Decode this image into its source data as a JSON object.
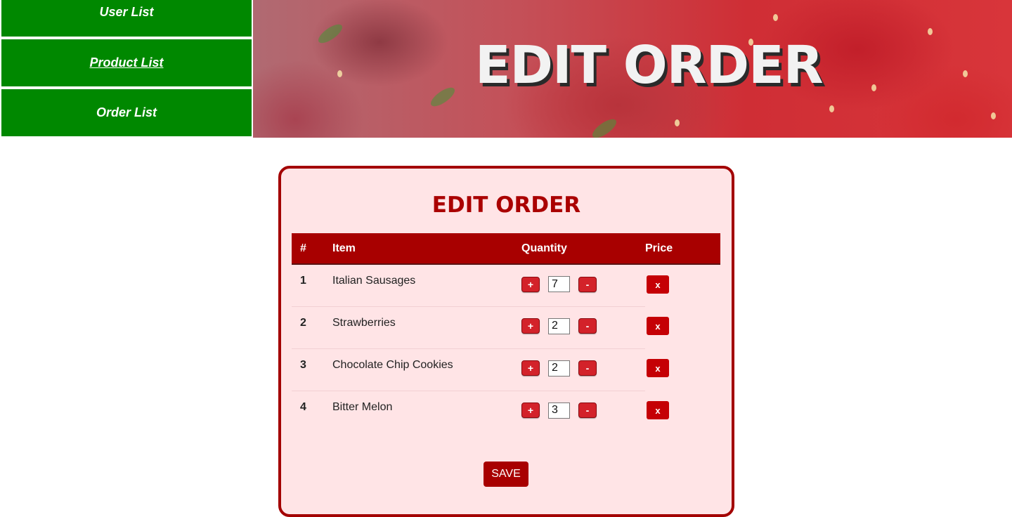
{
  "nav": {
    "items": [
      {
        "label": "User List"
      },
      {
        "label": "Product List"
      },
      {
        "label": "Order List"
      }
    ]
  },
  "hero": {
    "title": "EDIT ORDER"
  },
  "card": {
    "title": "EDIT ORDER",
    "table": {
      "headers": {
        "num": "#",
        "item": "Item",
        "quantity": "Quantity",
        "price": "Price"
      },
      "rows": [
        {
          "num": "1",
          "item": "Italian Sausages",
          "qty": "7"
        },
        {
          "num": "2",
          "item": "Strawberries",
          "qty": "2"
        },
        {
          "num": "3",
          "item": "Chocolate Chip Cookies",
          "qty": "2"
        },
        {
          "num": "4",
          "item": "Bitter Melon",
          "qty": "3"
        }
      ],
      "plus_label": "+",
      "minus_label": "-",
      "remove_label": "x"
    },
    "save_label": "SAVE"
  },
  "colors": {
    "nav_bg": "#008800",
    "accent": "#a80000",
    "card_bg": "#ffe4e6"
  }
}
